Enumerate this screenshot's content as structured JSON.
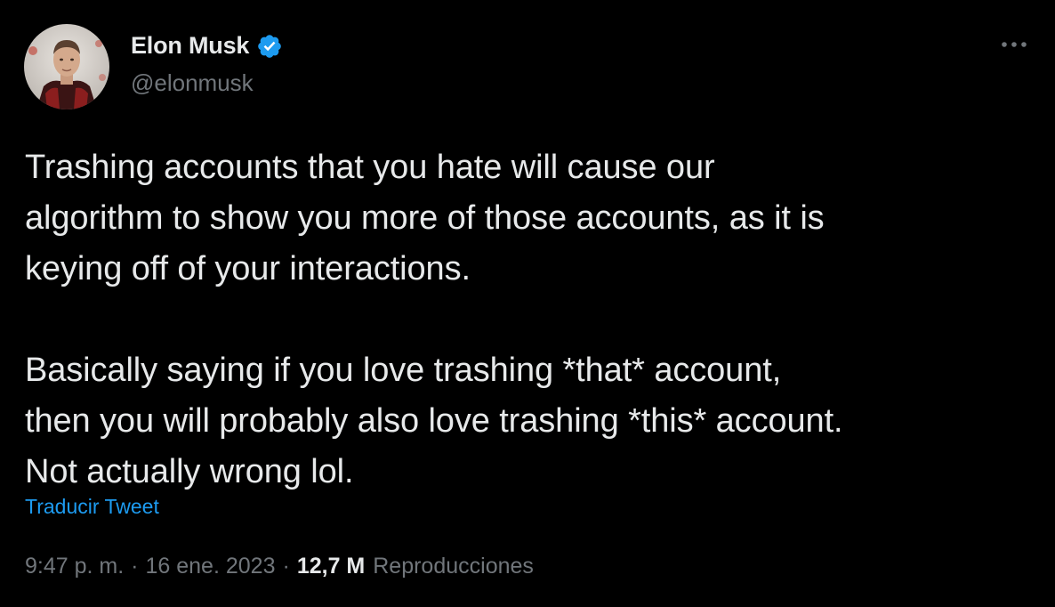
{
  "author": {
    "display_name": "Elon Musk",
    "handle": "@elonmusk",
    "verified": true,
    "verified_color": "#1d9bf0",
    "avatar_icon": "user-avatar-photo"
  },
  "more_icon": "more-horizontal-icon",
  "tweet": {
    "text": "Trashing accounts that you hate will cause our\nalgorithm to show you more of those accounts, as it is\nkeying off of your interactions.\n\nBasically saying if you love trashing *that* account,\nthen you will probably also love trashing *this* account.\nNot actually wrong lol.",
    "translate_label": "Traducir Tweet",
    "time": "9:47 p. m.",
    "date": "16 ene. 2023",
    "separator": "·",
    "views_count": "12,7 M",
    "views_label": "Reproducciones"
  },
  "colors": {
    "background": "#000000",
    "primary_text": "#e7e9ea",
    "secondary_text": "#71767b",
    "link": "#1d9bf0"
  }
}
